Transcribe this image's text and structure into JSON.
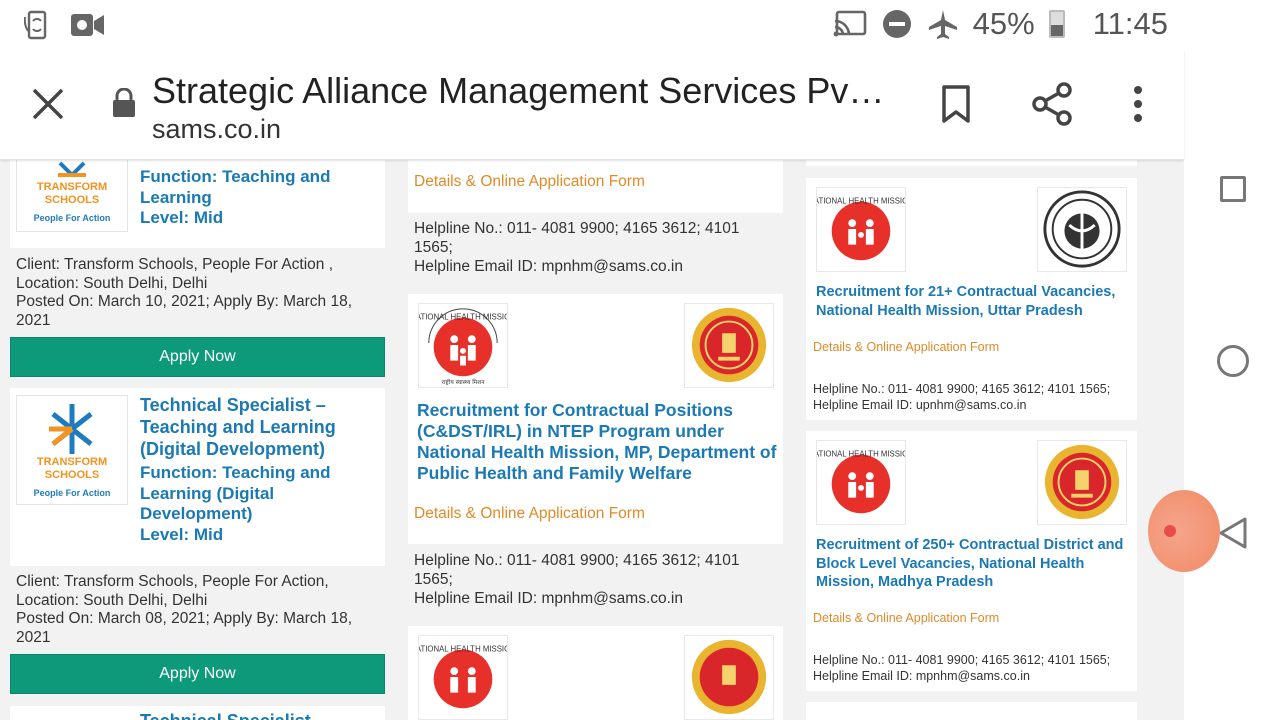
{
  "status_bar": {
    "battery_percent": "45%",
    "time": "11:45",
    "left_icons": [
      "phone-sync-icon",
      "video-camera-icon"
    ],
    "right_icons": [
      "cast-icon",
      "do-not-disturb-icon",
      "airplane-mode-icon",
      "battery-icon"
    ]
  },
  "toolbar": {
    "title": "Strategic Alliance Management Services Pv…",
    "url": "sams.co.in",
    "icons": [
      "close-icon",
      "lock-icon",
      "bookmark-icon",
      "share-icon",
      "more-vert-icon"
    ]
  },
  "left_column": {
    "card1": {
      "logo_name_line1": "TRANSFORM",
      "logo_name_line2": "SCHOOLS",
      "logo_tagline": "People For Action",
      "function": "Function: Teaching and Learning",
      "level": "Level: Mid",
      "client": "Client: Transform Schools, People For Action , Location: South Delhi, Delhi",
      "posted": "Posted On: March 10, 2021; Apply By: March 18, 2021",
      "apply_label": "Apply Now"
    },
    "card2": {
      "logo_name_line1": "TRANSFORM",
      "logo_name_line2": "SCHOOLS",
      "logo_tagline": "People For Action",
      "title": "Technical Specialist – Teaching and Learning (Digital Development)",
      "function": "Function: Teaching and Learning (Digital Development)",
      "level": "Level: Mid",
      "client": "Client: Transform Schools, People For Action, Location: South Delhi, Delhi",
      "posted": "Posted On: March 08, 2021; Apply By: March 18, 2021",
      "apply_label": "Apply Now"
    },
    "card3": {
      "title": "Technical Specialist"
    }
  },
  "middle_column": {
    "card1": {
      "details_label": "Details & Online Application Form",
      "helpline": "Helpline No.: 011- 4081 9900; 4165 3612; 4101 1565;",
      "email": "Helpline Email ID: mpnhm@sams.co.in"
    },
    "card2": {
      "title": "Recruitment for Contractual Positions (C&DST/IRL) in NTEP Program under National Health Mission, MP, Department of Public Health and Family Welfare",
      "details_label": "Details & Online Application Form",
      "helpline": "Helpline No.: 011- 4081 9900; 4165 3612; 4101 1565;",
      "email": "Helpline Email ID: mpnhm@sams.co.in"
    }
  },
  "right_column": {
    "card1": {
      "title": "Recruitment for 21+ Contractual Vacancies, National Health Mission, Uttar Pradesh",
      "details_label": "Details & Online Application Form",
      "helpline": "Helpline No.: 011- 4081 9900; 4165 3612; 4101 1565;",
      "email": "Helpline Email ID: upnhm@sams.co.in"
    },
    "card2": {
      "title": "Recruitment of 250+ Contractual District and Block Level Vacancies, National Health Mission, Madhya Pradesh",
      "details_label": "Details & Online Application Form",
      "helpline": "Helpline No.: 011- 4081 9900; 4165 3612; 4101 1565;",
      "email": "Helpline Email ID: mpnhm@sams.co.in"
    }
  },
  "logos": {
    "nhm_text": "NATIONAL HEALTH MISSION",
    "nhm_hindi": "राष्ट्रीय स्वास्थ्य मिशन"
  },
  "colors": {
    "link_blue": "#1b79b4",
    "details_orange": "#e08a28",
    "apply_green": "#0d9a7a",
    "nhm_red": "#e8302a"
  },
  "nav": {
    "icons": [
      "recents-square-icon",
      "home-circle-icon",
      "back-triangle-icon"
    ]
  }
}
